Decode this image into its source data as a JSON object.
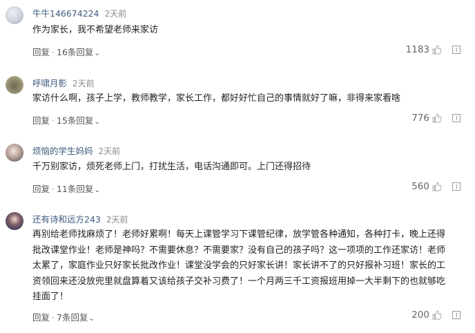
{
  "comments": [
    {
      "username": "牛牛146674224",
      "time": "2天前",
      "text": "作为家长，我不希望老师来家访",
      "reply_label": "回复",
      "replies_label": "16条回复",
      "likes": "1183"
    },
    {
      "username": "呼啸月影",
      "time": "2天前",
      "text": "家访什么啊，孩子上学，教师教学，家长工作，都好好忙自己的事情就好了嘛，非得来家看啥",
      "reply_label": "回复",
      "replies_label": "15条回复",
      "likes": "776"
    },
    {
      "username": "烦恼的学生妈妈",
      "time": "2天前",
      "text": "千万别家访，烦死老师上门，打扰生活，电话沟通即可。上门还得招待",
      "reply_label": "回复",
      "replies_label": "11条回复",
      "likes": "560"
    },
    {
      "username": "还有诗和远方243",
      "time": "2天前",
      "text": "再别给老师找麻烦了！老师好累啊！每天上课管学习下课管纪律，放学管各种通知，各种打卡，晚上还得批改课堂作业！老师是神吗？不需要休息？不需要家？没有自己的孩子吗？这一项项的工作还家访！老师太累了，家庭作业只好家长批改作业！课堂没学会的只好家长讲！家长讲不了的只好报补习班！家长的工资领回来还没放兜里就盘算着又该给孩子交补习费了！一个月两三千工资报班用掉一大半剩下的也就够吃挂面了！",
      "reply_label": "回复",
      "replies_label": "7条回复",
      "likes": "200"
    }
  ],
  "icons": {
    "thumb": "thumbs-up-icon",
    "report": "report-icon",
    "chevron": "chevron-down-icon"
  }
}
